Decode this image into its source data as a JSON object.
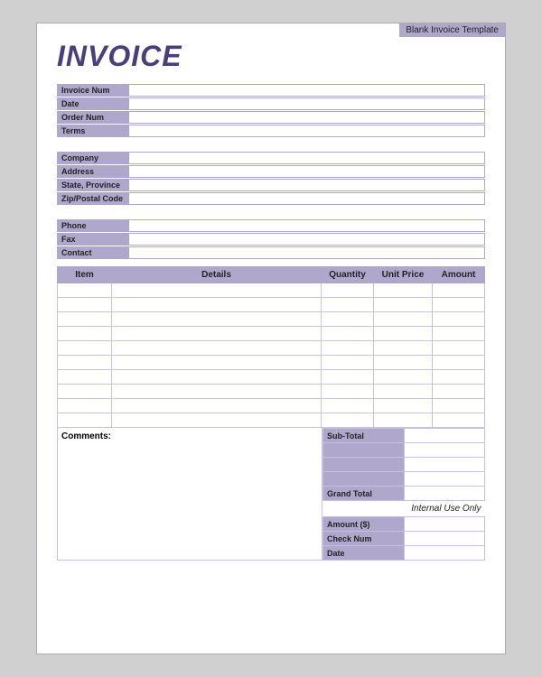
{
  "template_label": "Blank Invoice Template",
  "invoice_title": "INVOICE",
  "info_fields": {
    "invoice_num_label": "Invoice Num",
    "date_label": "Date",
    "order_num_label": "Order Num",
    "terms_label": "Terms",
    "company_label": "Company",
    "address_label": "Address",
    "state_province_label": "State, Province",
    "zip_postal_label": "Zip/Postal Code",
    "phone_label": "Phone",
    "fax_label": "Fax",
    "contact_label": "Contact"
  },
  "table_headers": {
    "item": "Item",
    "details": "Details",
    "quantity": "Quantity",
    "unit_price": "Unit Price",
    "amount": "Amount"
  },
  "item_rows_count": 10,
  "comments_label": "Comments:",
  "totals": {
    "sub_total_label": "Sub-Total",
    "grand_total_label": "Grand Total",
    "internal_use_label": "Internal Use Only",
    "amount_label": "Amount ($)",
    "check_num_label": "Check Num",
    "date_label": "Date"
  }
}
